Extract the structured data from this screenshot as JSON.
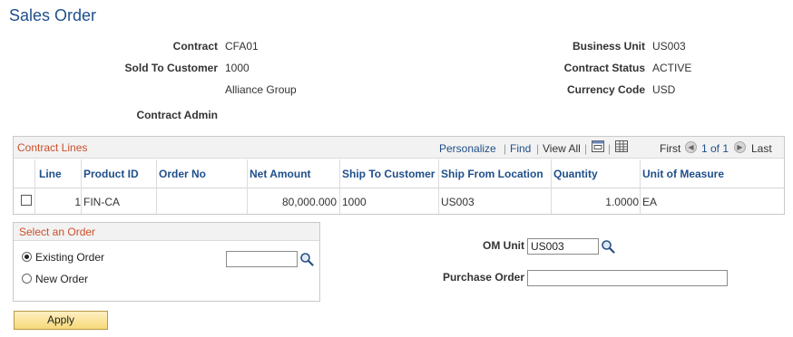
{
  "page": {
    "title": "Sales Order"
  },
  "header": {
    "contract_label": "Contract",
    "contract_value": "CFA01",
    "sold_to_label": "Sold To Customer",
    "sold_to_value": "1000",
    "customer_name": "Alliance Group",
    "contract_admin_label": "Contract Admin",
    "business_unit_label": "Business Unit",
    "business_unit_value": "US003",
    "contract_status_label": "Contract Status",
    "contract_status_value": "ACTIVE",
    "currency_label": "Currency Code",
    "currency_value": "USD"
  },
  "grid": {
    "title": "Contract Lines",
    "personalize": "Personalize",
    "find": "Find",
    "view_all": "View All",
    "first": "First",
    "range": "1 of 1",
    "last": "Last",
    "columns": [
      "Line",
      "Product ID",
      "Order No",
      "Net Amount",
      "Ship To Customer",
      "Ship From Location",
      "Quantity",
      "Unit of Measure"
    ],
    "rows": [
      {
        "line": "1",
        "product_id": "FIN-CA",
        "order_no": "",
        "net_amount": "80,000.000",
        "ship_to": "1000",
        "ship_from": "US003",
        "quantity": "1.0000",
        "uom": "EA"
      }
    ]
  },
  "select_order": {
    "title": "Select an Order",
    "existing_label": "Existing Order",
    "new_label": "New Order",
    "existing_value": ""
  },
  "om": {
    "unit_label": "OM Unit",
    "unit_value": "US003",
    "po_label": "Purchase Order",
    "po_value": ""
  },
  "actions": {
    "apply_label": "Apply"
  }
}
